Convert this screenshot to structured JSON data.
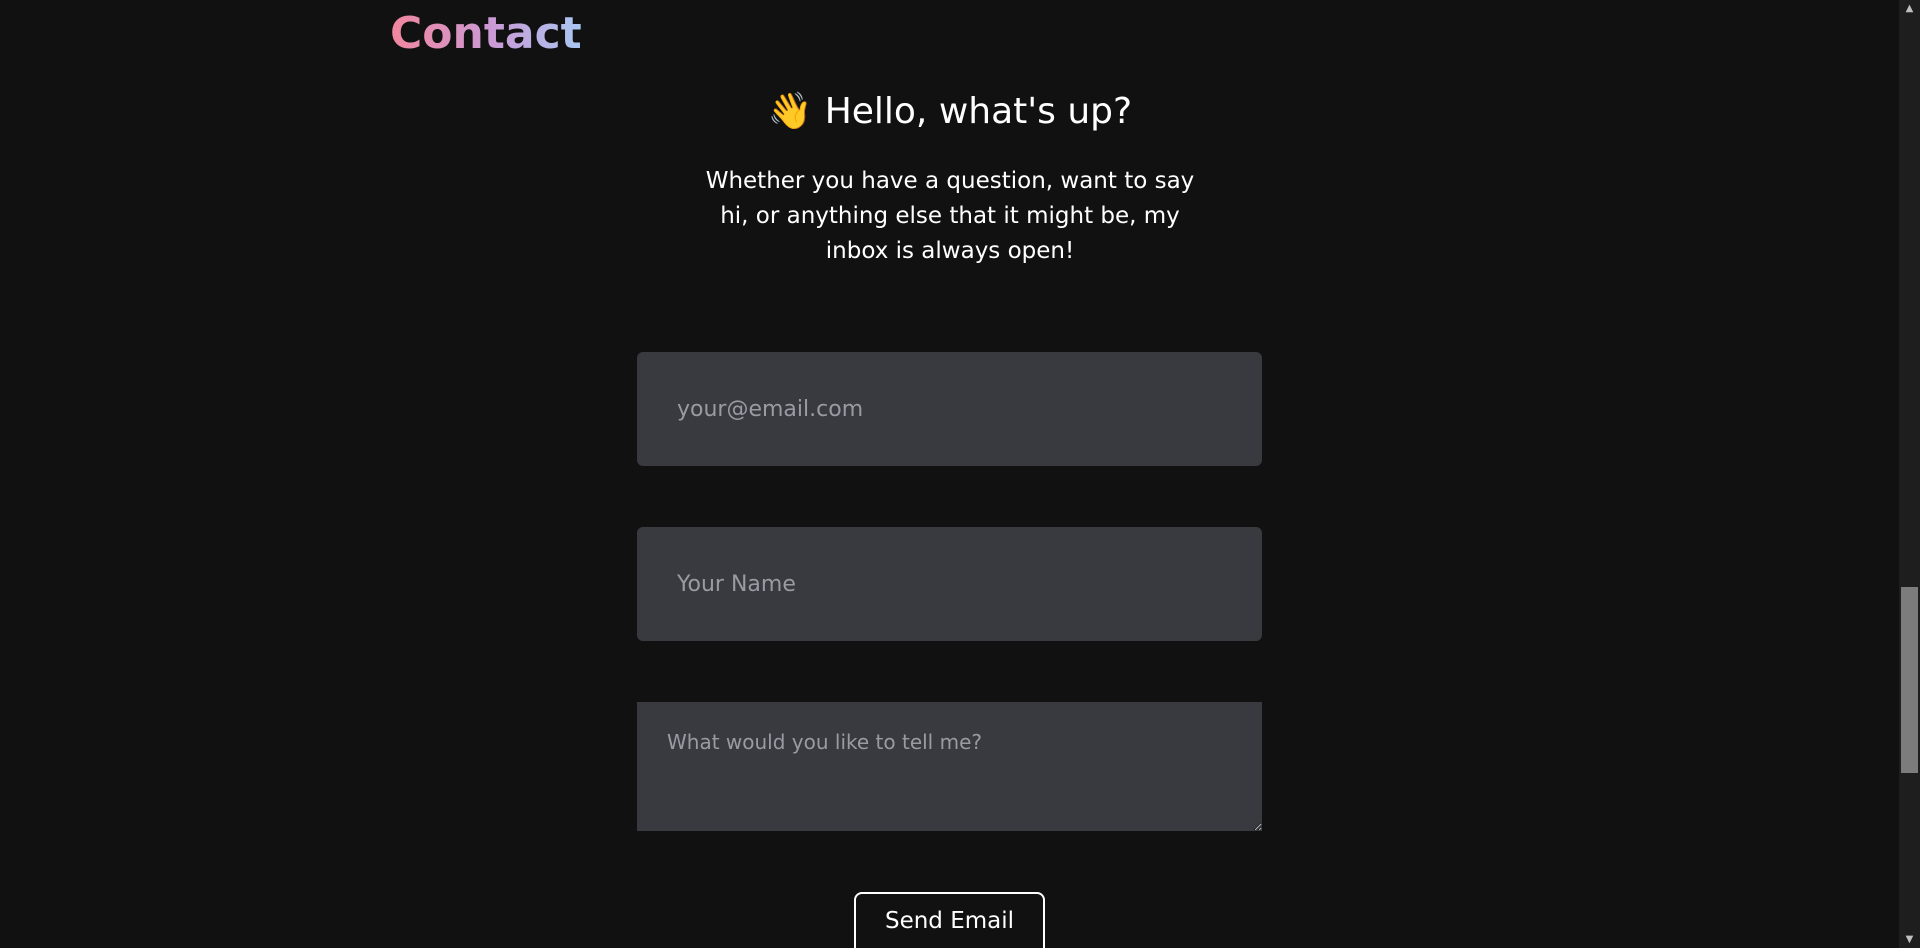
{
  "section": {
    "title": "Contact"
  },
  "greeting": {
    "emoji": "👋",
    "text": "Hello, what's up?"
  },
  "intro": {
    "text": "Whether you have a question, want to say hi, or anything else that it might be, my inbox is always open!"
  },
  "form": {
    "email_placeholder": "your@email.com",
    "name_placeholder": "Your Name",
    "message_placeholder": "What would you like to tell me?",
    "submit_label": "Send Email"
  },
  "scrollbar": {
    "up_glyph": "▲",
    "down_glyph": "▼"
  },
  "colors": {
    "background": "#111112",
    "field_background": "#393a40",
    "title_gradient": [
      "#f2869e",
      "#c99bd6",
      "#a9c8f2"
    ]
  }
}
